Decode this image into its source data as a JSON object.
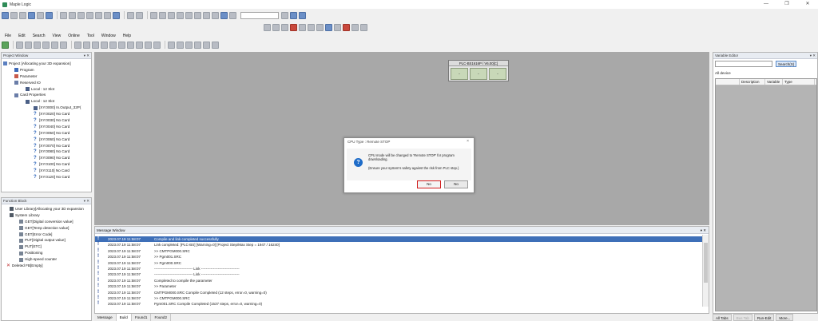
{
  "app": {
    "title": "Maple Logic"
  },
  "menu": [
    "File",
    "Edit",
    "Search",
    "View",
    "Online",
    "Tool",
    "Window",
    "Help"
  ],
  "project_window": {
    "header": "Project Window",
    "items": [
      "Project [Allocating your 3D expansion]",
      "Program",
      "Parameter",
      "Reserved IO",
      "Local : 12 Slot",
      "Card Properties",
      "Local : 12 Slot",
      "[XY:0000] In.Output_32P(",
      "[XY:0020] No Card",
      "[XY:0030] No Card",
      "[XY:0040] No Card",
      "[XY:0050] No Card",
      "[XY:0060] No Card",
      "[XY:0070] No Card",
      "[XY:0080] No Card",
      "[XY:0090] No Card",
      "[XY:0100] No Card",
      "[XY:0110] No Card",
      "[XY:0120] No Card"
    ]
  },
  "function_block": {
    "header": "Function Block",
    "items": [
      "User Library[Allocating your 3D expansion",
      "System Library",
      "GET[Digital conversion value]",
      "GET[Temp detection value]",
      "GET[Error Code]",
      "PUT[Digital output value]",
      "PUT[ETC]",
      "Positioning",
      "High-speed counter",
      "Deleted FB[Empty]"
    ]
  },
  "plc": {
    "title": "PLC-BS1616P / V6.00[C]",
    "slots": [
      "-",
      "-",
      "-"
    ]
  },
  "dialog": {
    "title": "CPU Type : Remote STOP",
    "close": "×",
    "message": "CPU mode will be changed to 'Remote STOP' for program downloading.",
    "note": "(Ensure your system's safety against the risk from PLC stop.)",
    "btn_no_highlight": "No",
    "btn_no": "No"
  },
  "message_window": {
    "header": "Message Window",
    "rows": [
      {
        "ts": "2023.07.19 11:58:07",
        "text": "Compile and link completed successfully"
      },
      {
        "ts": "2023.07.19 11:58:07",
        "text": "Link completed: [PLC-BS] [Warning=0] [Project Step/Max Step = 1947 / 16240]"
      },
      {
        "ts": "2023.07.19 11:58:07",
        "text": ">> CMTPGM000.SRC"
      },
      {
        "ts": "2023.07.19 11:58:07",
        "text": ">> Pgm001.SRC"
      },
      {
        "ts": "2023.07.19 11:58:07",
        "text": ">> Pgm000.SRC"
      },
      {
        "ts": "2023.07.19 11:58:07",
        "text": "-------------------------------- Link --------------------------------"
      },
      {
        "ts": "2023.07.19 11:58:07",
        "text": "-------------------------------- Link --------------------------------"
      },
      {
        "ts": "2023.07.19 11:58:07",
        "text": "Completed to compile the parameter"
      },
      {
        "ts": "2023.07.19 11:58:07",
        "text": ">> Parameter"
      },
      {
        "ts": "2023.07.19 11:58:07",
        "text": "CMTPGM000.SRC Compile Completed (12 steps, error=0, warning=0)"
      },
      {
        "ts": "2023.07.19 11:58:07",
        "text": ">> CMTPGM000.SRC"
      },
      {
        "ts": "2023.07.19 11:58:07",
        "text": "Pgm001.SRC Compile Completed (1537 steps, error=0, warning=0)"
      }
    ],
    "tabs": [
      "Message",
      "Build",
      "Found1",
      "Found2"
    ]
  },
  "variable_editor": {
    "header": "Variable Editor",
    "search_btn": "Search(S)",
    "device_label": "All device",
    "columns": [
      "Description",
      "Variable",
      "Type"
    ],
    "tabs": [
      "All Tabs",
      "Bus Tab",
      "Run-Edit",
      "More..."
    ]
  },
  "window_controls": [
    "—",
    "❐",
    "✕"
  ],
  "colors": {
    "accent": "#3e6fb8",
    "highlight_border": "#d11a1a",
    "workspace": "#a8a8a8"
  }
}
